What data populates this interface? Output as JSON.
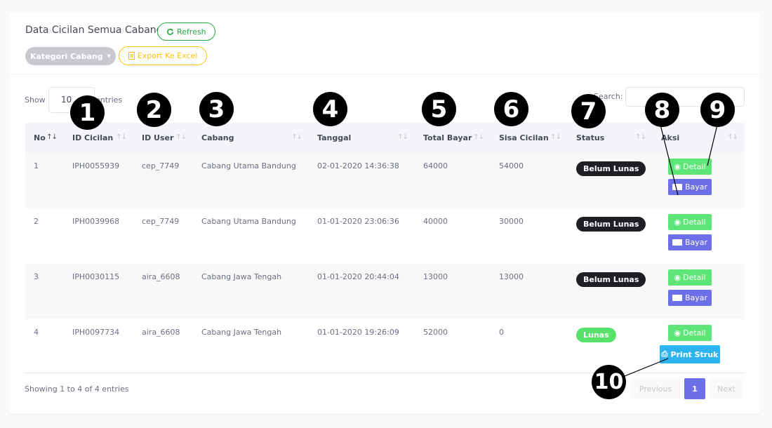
{
  "header": {
    "title": "Data Cicilan Semua Cabang",
    "refresh_label": "Refresh",
    "kategori_label": "Kategori Cabang",
    "export_label": "Export Ke Excel"
  },
  "controls": {
    "show_label": "Show",
    "length_value": "10",
    "entries_label": "entries",
    "search_label": "Search:"
  },
  "table": {
    "columns": [
      "No",
      "ID Cicilan",
      "ID User",
      "Cabang",
      "Tanggal",
      "Total Bayar",
      "Sisa Cicilan",
      "Status",
      "Aksi"
    ],
    "sort_icon": "↑↓",
    "rows": [
      {
        "no": "1",
        "id_cicilan": "IPH0055939",
        "id_user": "cep_7749",
        "cabang": "Cabang Utama Bandung",
        "tanggal": "02-01-2020 14:36:38",
        "total_bayar": "64000",
        "sisa_cicilan": "54000",
        "status": "Belum Lunas"
      },
      {
        "no": "2",
        "id_cicilan": "IPH0039968",
        "id_user": "cep_7749",
        "cabang": "Cabang Utama Bandung",
        "tanggal": "01-01-2020 23:06:36",
        "total_bayar": "40000",
        "sisa_cicilan": "30000",
        "status": "Belum Lunas"
      },
      {
        "no": "3",
        "id_cicilan": "IPH0030115",
        "id_user": "aira_6608",
        "cabang": "Cabang Jawa Tengah",
        "tanggal": "01-01-2020 20:44:04",
        "total_bayar": "13000",
        "sisa_cicilan": "13000",
        "status": "Belum Lunas"
      },
      {
        "no": "4",
        "id_cicilan": "IPH0097734",
        "id_user": "aira_6608",
        "cabang": "Cabang Jawa Tengah",
        "tanggal": "01-01-2020 19:26:09",
        "total_bayar": "52000",
        "sisa_cicilan": "0",
        "status": "Lunas"
      }
    ],
    "detail_label": "Detail",
    "bayar_label": "Bayar",
    "print_label": "Print Struk"
  },
  "footer": {
    "showing": "Showing 1 to 4 of 4 entries",
    "prev": "Previous",
    "page": "1",
    "next": "Next"
  },
  "markers": [
    "1",
    "2",
    "3",
    "4",
    "5",
    "6",
    "7",
    "8",
    "9",
    "10"
  ],
  "colors": {
    "refresh": "#28a745",
    "export": "#ffc107",
    "detail": "#5ee577",
    "bayar": "#6c6fe8",
    "print": "#2db4ef",
    "badge_dark": "#1e1f24",
    "badge_lunas": "#57e36b"
  }
}
